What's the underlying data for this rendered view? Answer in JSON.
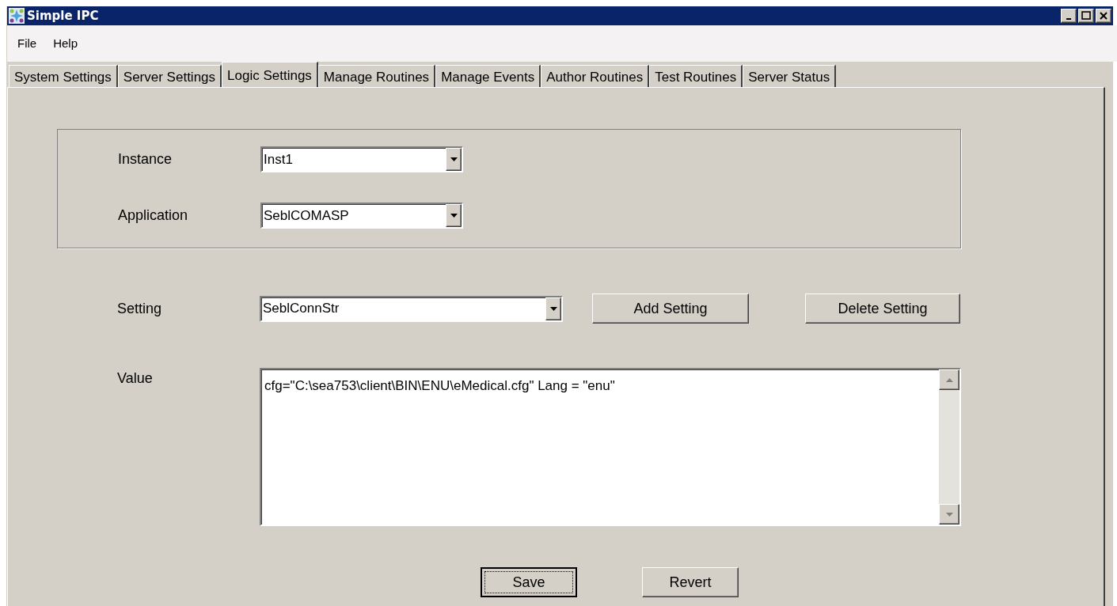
{
  "window": {
    "title": "Simple IPC"
  },
  "menu": [
    "File",
    "Help"
  ],
  "tabs": [
    {
      "label": "System Settings",
      "selected": false
    },
    {
      "label": "Server Settings",
      "selected": false
    },
    {
      "label": "Logic Settings",
      "selected": true
    },
    {
      "label": "Manage Routines",
      "selected": false
    },
    {
      "label": "Manage Events",
      "selected": false
    },
    {
      "label": "Author Routines",
      "selected": false
    },
    {
      "label": "Test Routines",
      "selected": false
    },
    {
      "label": "Server Status",
      "selected": false
    }
  ],
  "group": [
    {
      "label": "Instance",
      "value": "Inst1"
    },
    {
      "label": "Application",
      "value": "SeblCOMASP"
    }
  ],
  "setting": {
    "label": "Setting",
    "value": "SeblConnStr"
  },
  "setting_buttons": [
    "Add Setting",
    "Delete Setting"
  ],
  "value": {
    "label": "Value",
    "text": "cfg=\"C:\\sea753\\client\\BIN\\ENU\\eMedical.cfg\" Lang = \"enu\""
  },
  "buttons": [
    {
      "label": "Save",
      "focused": true
    },
    {
      "label": "Revert",
      "focused": false
    }
  ]
}
